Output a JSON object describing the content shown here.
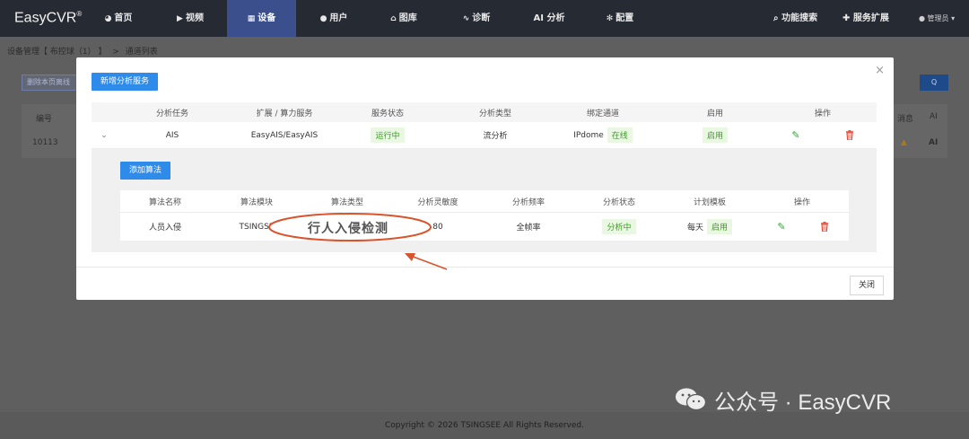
{
  "app": {
    "name": "EasyCVR",
    "mark": "®"
  },
  "nav": {
    "items": [
      {
        "label": "首页",
        "icon": "dashboard-icon"
      },
      {
        "label": "视频",
        "icon": "play-circle-icon"
      },
      {
        "label": "设备",
        "icon": "device-grid-icon",
        "active": true
      },
      {
        "label": "用户",
        "icon": "user-icon"
      },
      {
        "label": "图库",
        "icon": "bank-icon"
      },
      {
        "label": "诊断",
        "icon": "pulse-icon"
      },
      {
        "label": "AI 分析",
        "icon": ""
      },
      {
        "label": "配置",
        "icon": "gear-icon"
      }
    ],
    "search_label": "功能搜索",
    "extend_label": "服务扩展",
    "user_label": "管理员"
  },
  "breadcrumb": {
    "root": "设备管理【 布控球（1） 】",
    "sep": ">",
    "current": "通道列表"
  },
  "background": {
    "delete_button": "删除本页离线",
    "search_button": "Q",
    "headers": {
      "id": "编号",
      "msg": "消息",
      "ai": "AI"
    },
    "row": {
      "id": "10113",
      "ai": "AI"
    }
  },
  "modal": {
    "add_service_button": "新增分析服务",
    "close_x": "×",
    "service_table": {
      "headers": [
        "分析任务",
        "扩展 / 算力服务",
        "服务状态",
        "分析类型",
        "绑定通道",
        "启用",
        "操作"
      ],
      "row": {
        "expand_icon": "⌄",
        "task": "AIS",
        "service": "EasyAIS/EasyAIS",
        "status": "运行中",
        "type": "流分析",
        "channel": "IPdome",
        "channel_status": "在线",
        "enabled": "启用"
      }
    },
    "add_algorithm_button": "添加算法",
    "algo_table": {
      "headers": [
        "算法名称",
        "算法模块",
        "算法类型",
        "分析灵敏度",
        "分析频率",
        "分析状态",
        "计划模板",
        "操作"
      ],
      "row": {
        "name": "人员入侵",
        "module": "TSINGSE",
        "type": "",
        "sensitivity": "80",
        "frequency": "全帧率",
        "status": "分析中",
        "schedule": "每天",
        "schedule_status": "启用"
      }
    },
    "close_button": "关闭"
  },
  "annotation": {
    "text": "行人入侵检测",
    "color": "#d9532c"
  },
  "footer": {
    "copyright": "Copyright © 2026 TSINGSEE All Rights Reserved."
  },
  "watermark": {
    "text": "公众号 · EasyCVR"
  },
  "colors": {
    "nav_bg": "#262a33",
    "nav_active": "#3a4f8c",
    "primary": "#2f8bea",
    "success": "#3c9c23",
    "danger": "#e74c3c"
  }
}
